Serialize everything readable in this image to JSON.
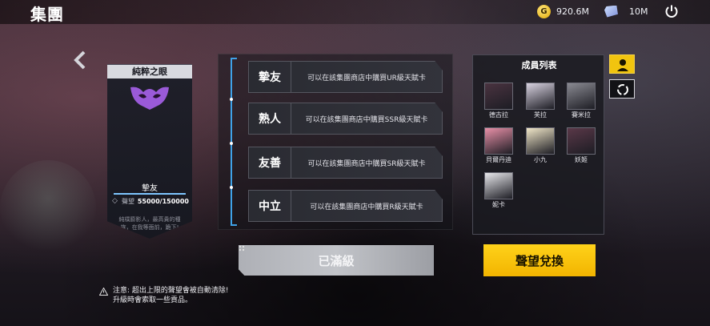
{
  "header": {
    "title": "集團",
    "gold": {
      "icon": "gold-coin-icon",
      "value": "920.6M"
    },
    "crystal": {
      "icon": "crystal-gem-icon",
      "value": "10M"
    },
    "power_icon": "power-icon"
  },
  "card": {
    "title": "純粹之眼",
    "rank": "摯友",
    "favor_label": "聲望",
    "favor_value": "55000/150000",
    "description": "純樸膨影人，最高貴的種族，在我等面前，跪下!"
  },
  "ranks": [
    {
      "name": "摯友",
      "desc": "可以在該集團商店中購買UR級天賦卡"
    },
    {
      "name": "熟人",
      "desc": "可以在該集團商店中購買SSR級天賦卡"
    },
    {
      "name": "友善",
      "desc": "可以在該集團商店中購買SR級天賦卡"
    },
    {
      "name": "中立",
      "desc": "可以在該集團商店中購買R級天賦卡"
    }
  ],
  "members": {
    "title": "成員列表",
    "list": [
      {
        "name": "德古拉",
        "color": "#4a3340"
      },
      {
        "name": "芙拉",
        "color": "#d8d2e0"
      },
      {
        "name": "賽米拉",
        "color": "#8a8a92"
      },
      {
        "name": "貝爾丹迪",
        "color": "#e890a8"
      },
      {
        "name": "小九",
        "color": "#f0e6c8"
      },
      {
        "name": "妖姬",
        "color": "#5a3848"
      },
      {
        "name": "妮卡",
        "color": "#e8e8ec"
      }
    ]
  },
  "buttons": {
    "maxed": "已滿級",
    "exchange": "聲望兌換"
  },
  "notice": {
    "line1": "注意: 超出上限的聲望會被自動清除!",
    "line2": "升級時會索取一些貢品。"
  },
  "colors": {
    "accent_yellow": "#f2b400",
    "timeline_blue": "#3fa2e8"
  }
}
